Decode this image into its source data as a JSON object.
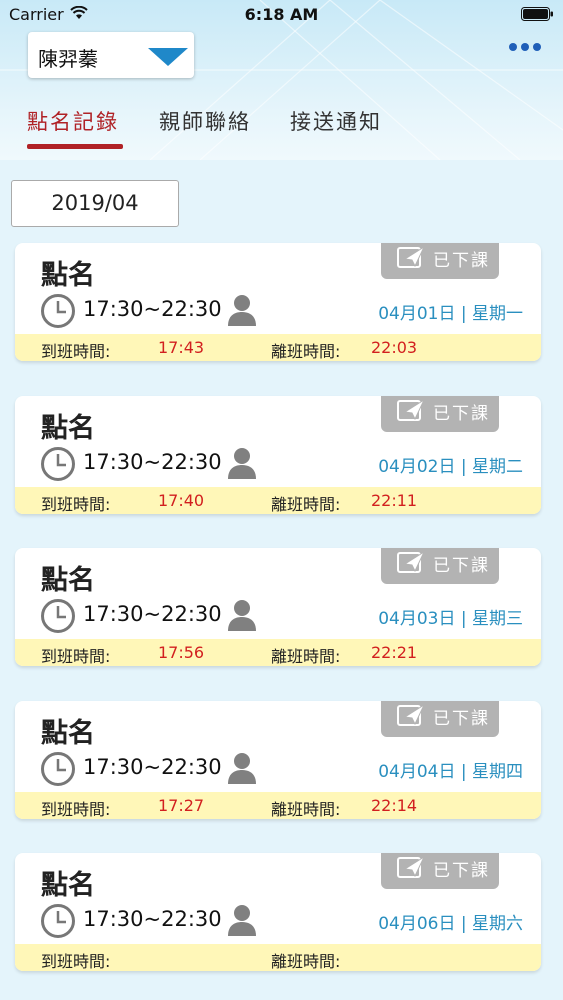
{
  "status_bar": {
    "carrier": "Carrier",
    "time": "6:18 AM"
  },
  "student_selector": {
    "name": "陳羿蓁"
  },
  "tabs": [
    {
      "label": "點名記錄",
      "active": true
    },
    {
      "label": "親師聯絡",
      "active": false
    },
    {
      "label": "接送通知",
      "active": false
    }
  ],
  "month_filter": "2019/04",
  "colors": {
    "accent_red": "#b02226",
    "date_blue": "#2a8fbf",
    "time_red": "#d21f1f",
    "badge_gray": "#b3b3b3",
    "bar_yellow": "#fff7b8"
  },
  "records": [
    {
      "title": "點名",
      "badge": "已下課",
      "time_range": "17:30~22:30",
      "date": "04月01日 | 星期一",
      "arrive_label": "到班時間:",
      "arrive_time": "17:43",
      "leave_label": "離班時間:",
      "leave_time": "22:03"
    },
    {
      "title": "點名",
      "badge": "已下課",
      "time_range": "17:30~22:30",
      "date": "04月02日 | 星期二",
      "arrive_label": "到班時間:",
      "arrive_time": "17:40",
      "leave_label": "離班時間:",
      "leave_time": "22:11"
    },
    {
      "title": "點名",
      "badge": "已下課",
      "time_range": "17:30~22:30",
      "date": "04月03日 | 星期三",
      "arrive_label": "到班時間:",
      "arrive_time": "17:56",
      "leave_label": "離班時間:",
      "leave_time": "22:21"
    },
    {
      "title": "點名",
      "badge": "已下課",
      "time_range": "17:30~22:30",
      "date": "04月04日 | 星期四",
      "arrive_label": "到班時間:",
      "arrive_time": "17:27",
      "leave_label": "離班時間:",
      "leave_time": "22:14"
    },
    {
      "title": "點名",
      "badge": "已下課",
      "time_range": "17:30~22:30",
      "date": "04月06日 | 星期六",
      "arrive_label": "到班時間:",
      "arrive_time": "",
      "leave_label": "離班時間:",
      "leave_time": ""
    }
  ]
}
